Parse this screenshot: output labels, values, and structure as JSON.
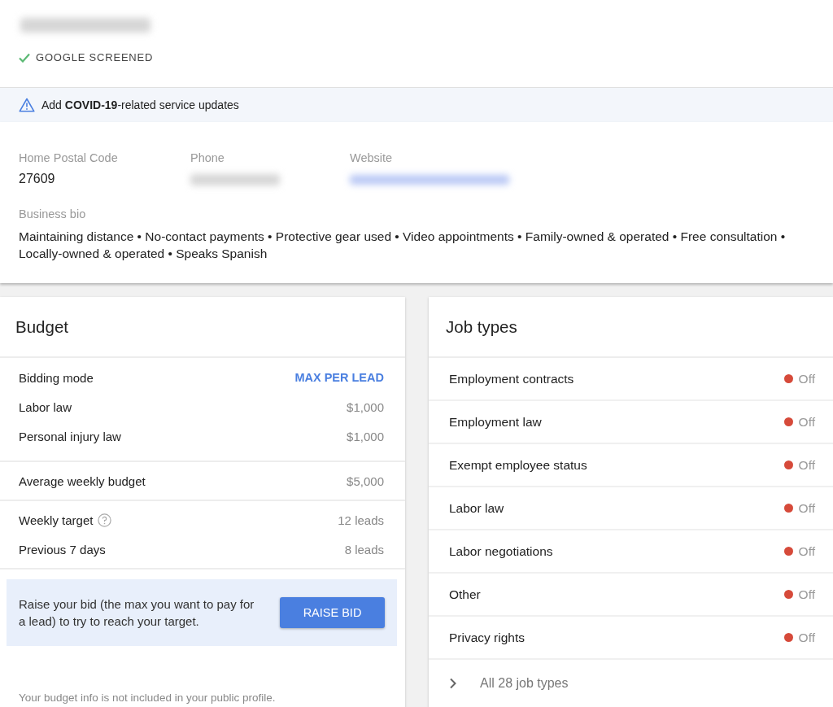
{
  "header": {
    "screened_label": "GOOGLE SCREENED"
  },
  "banner": {
    "text": "Add **COVID-19**-related service updates"
  },
  "details": {
    "postal_code": {
      "label": "Home Postal Code",
      "value": "27609"
    },
    "phone": {
      "label": "Phone"
    },
    "website": {
      "label": "Website"
    },
    "bio": {
      "label": "Business bio",
      "text": "Maintaining distance • No-contact payments • Protective gear used • Video appointments • Family-owned & operated • Free consultation • Locally-owned & operated • Speaks Spanish"
    }
  },
  "budget": {
    "title": "Budget",
    "bidding": {
      "label": "Bidding mode",
      "value": "MAX PER LEAD"
    },
    "bids": [
      {
        "label": "Labor law",
        "value": "$1,000"
      },
      {
        "label": "Personal injury law",
        "value": "$1,000"
      }
    ],
    "average": {
      "label": "Average weekly budget",
      "value": "$5,000"
    },
    "target": {
      "label": "Weekly target",
      "value": "12 leads"
    },
    "previous": {
      "label": "Previous 7 days",
      "value": "8 leads"
    },
    "tip": {
      "text": "Raise your bid (the max you want to pay for a lead) to try to reach your target.",
      "button": "RAISE BID"
    },
    "footnote": "Your budget info is not included in your public profile."
  },
  "job_types": {
    "title": "Job types",
    "items": [
      {
        "label": "Employment contracts",
        "status": "Off",
        "on": false
      },
      {
        "label": "Employment law",
        "status": "Off",
        "on": false
      },
      {
        "label": "Exempt employee status",
        "status": "Off",
        "on": false
      },
      {
        "label": "Labor law",
        "status": "Off",
        "on": false
      },
      {
        "label": "Labor negotiations",
        "status": "Off",
        "on": false
      },
      {
        "label": "Other",
        "status": "Off",
        "on": false
      },
      {
        "label": "Privacy rights",
        "status": "Off",
        "on": false
      }
    ],
    "all_link": "All 28 job types"
  }
}
